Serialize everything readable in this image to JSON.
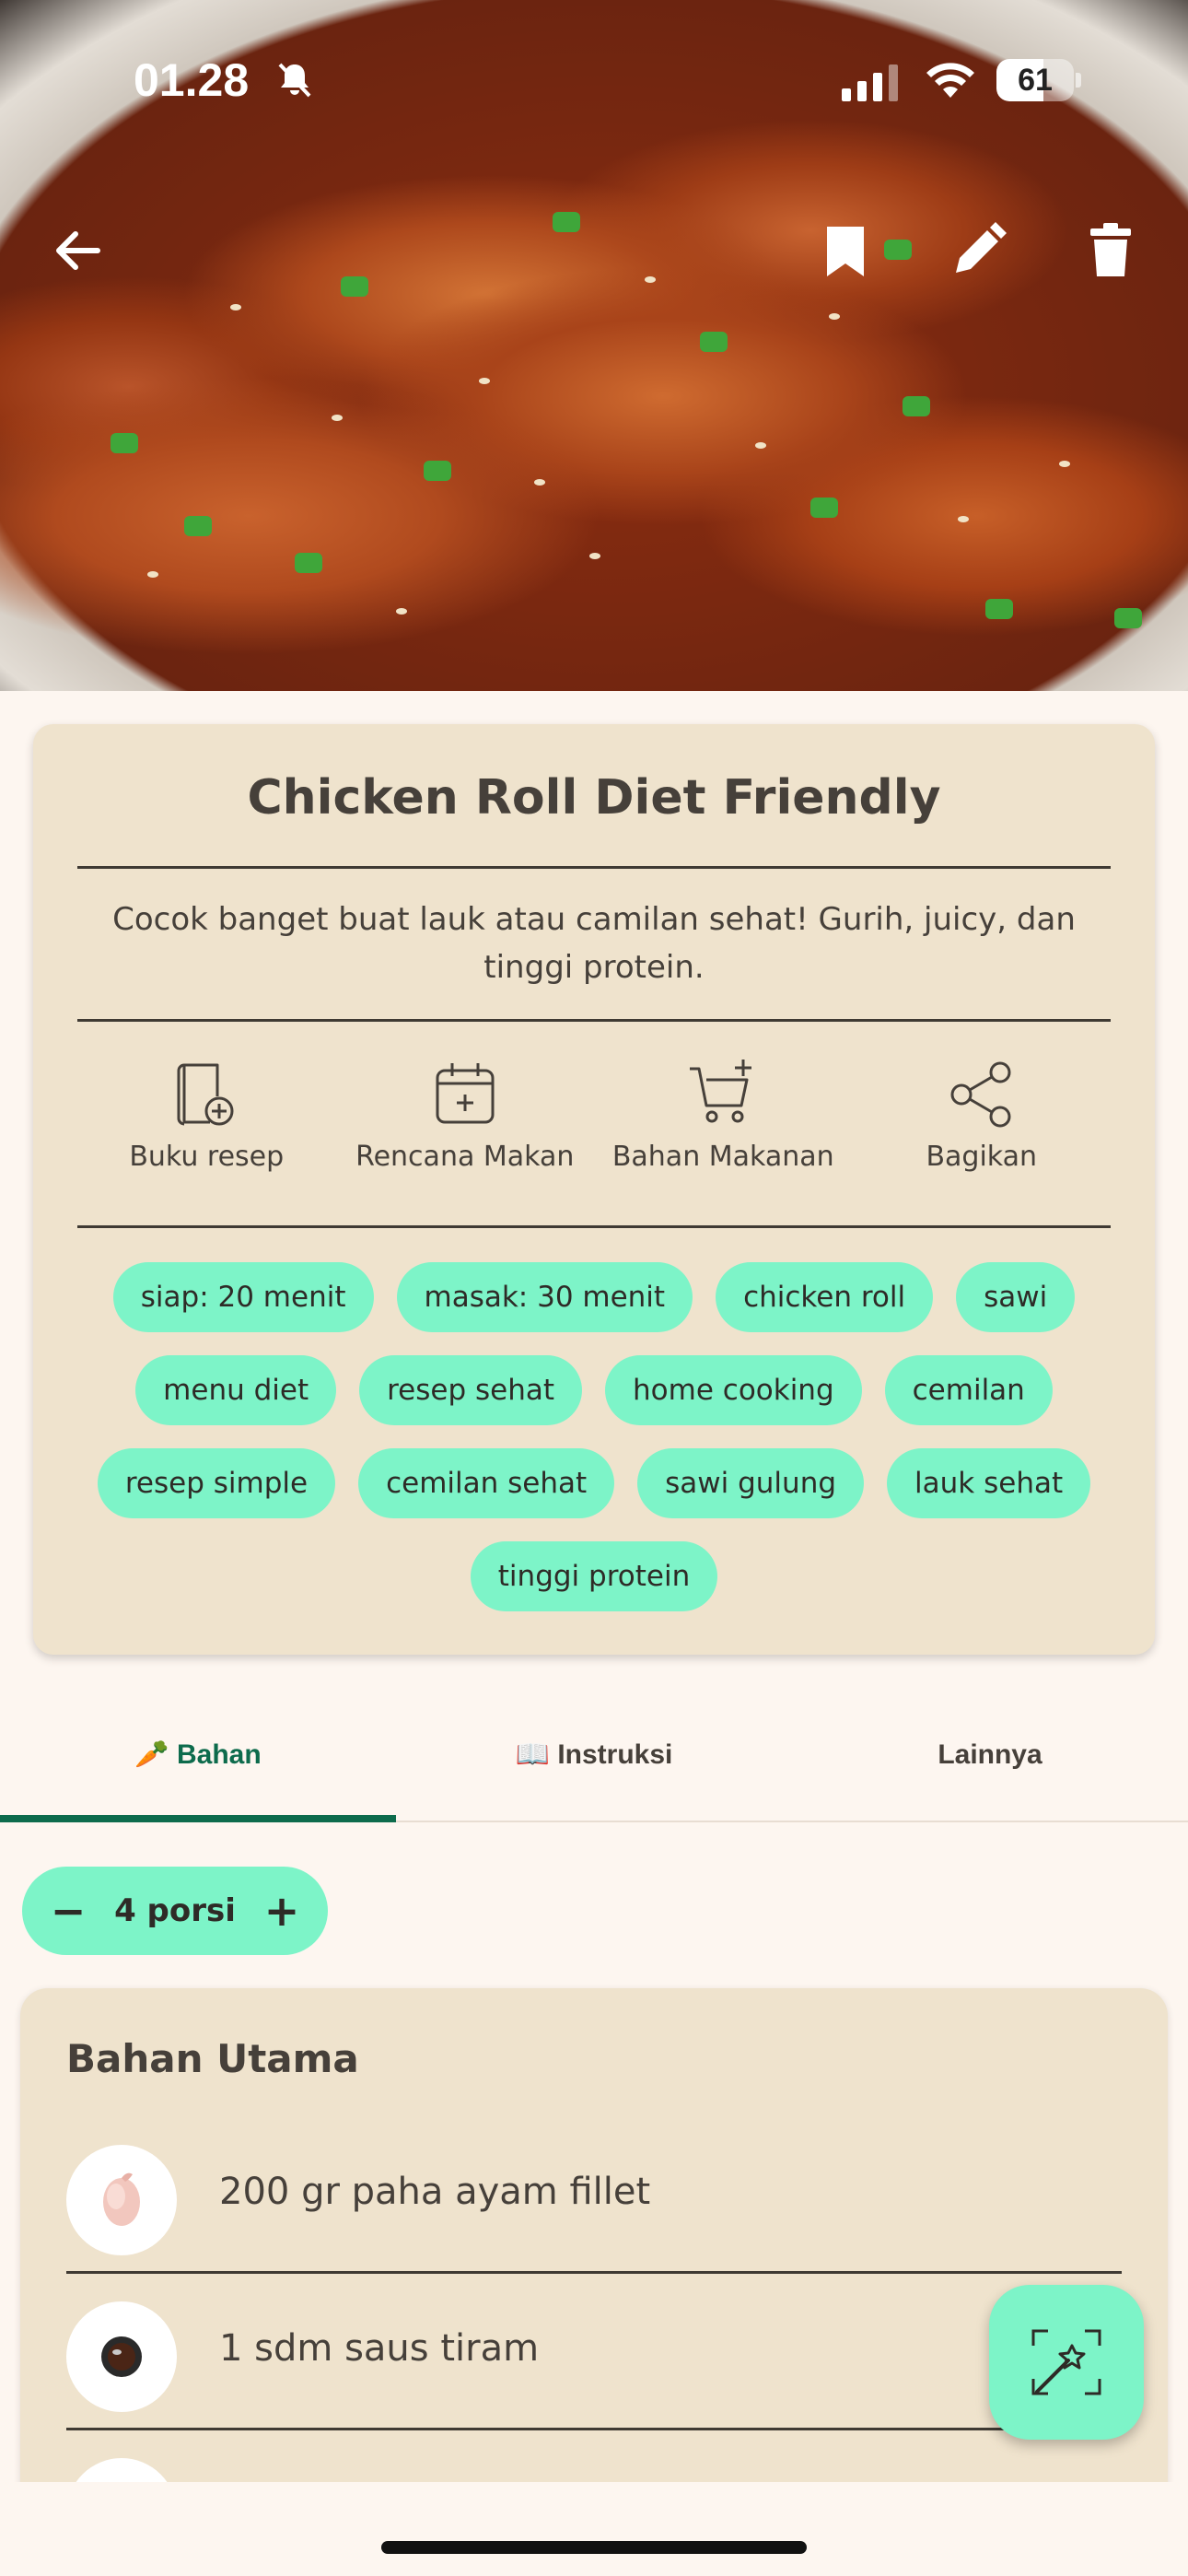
{
  "status_bar": {
    "time": "01.28",
    "battery": "61",
    "battery_level": 0.61
  },
  "recipe": {
    "title": "Chicken Roll Diet Friendly",
    "description": "Cocok banget buat lauk atau camilan sehat! Gurih, juicy, dan tinggi protein."
  },
  "actions": [
    {
      "label": "Buku resep",
      "icon": "book-add-icon"
    },
    {
      "label": "Rencana Makan",
      "icon": "calendar-add-icon"
    },
    {
      "label": "Bahan Makanan",
      "icon": "cart-add-icon"
    },
    {
      "label": "Bagikan",
      "icon": "share-icon"
    }
  ],
  "tags": [
    "siap: 20 menit",
    "masak: 30 menit",
    "chicken roll",
    "sawi",
    "menu diet",
    "resep sehat",
    "home cooking",
    "cemilan",
    "resep simple",
    "cemilan sehat",
    "sawi gulung",
    "lauk sehat",
    "tinggi protein"
  ],
  "tabs": [
    {
      "label": "🥕 Bahan",
      "active": true
    },
    {
      "label": "📖 Instruksi",
      "active": false
    },
    {
      "label": "Lainnya",
      "active": false
    }
  ],
  "servings": {
    "value": "4 porsi",
    "minus": "−",
    "plus": "+"
  },
  "ingredients": {
    "section_title": "Bahan Utama",
    "items": [
      {
        "text": "200 gr paha ayam fillet",
        "icon": "chicken-thigh-icon"
      },
      {
        "text": "1 sdm saus tiram",
        "icon": "oyster-sauce-icon"
      },
      {
        "text": "",
        "icon": "ingredient-icon"
      }
    ]
  },
  "colors": {
    "accent": "#7df4c8",
    "tab_active": "#0d6b4c",
    "card": "#efe3cd",
    "background": "#fdf6f0"
  }
}
